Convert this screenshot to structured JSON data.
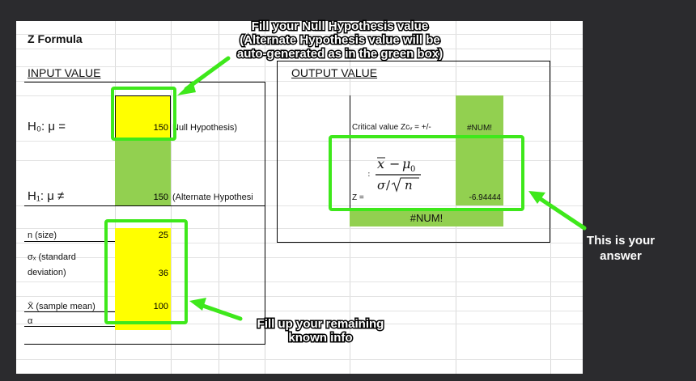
{
  "sheet": {
    "title": "Z Formula",
    "input_header": "INPUT VALUE",
    "output_header": "OUTPUT VALUE",
    "h0_label": "H₀: μ =",
    "h0_value": "150",
    "h0_note": "Null Hypothesis)",
    "h1_label": "H₁: μ ≠",
    "h1_value": "150",
    "h1_note": "(Alternate Hypothesi",
    "n_label": "n (size)",
    "n_value": "25",
    "sigma_label_1": "σₓ (standard",
    "sigma_label_2": "deviation)",
    "sigma_value": "36",
    "xbar_label": "X̄ (sample mean)",
    "xbar_value": "100",
    "alpha_label": "α",
    "critical_label": "Critical value Zᴄᵥ = +/-",
    "critical_value": "#NUM!",
    "z_label": "Z =",
    "z_value": "-6.94444",
    "result_value": "#NUM!"
  },
  "callouts": {
    "top": "Fill your Null Hypothesis value (Alternate Hypothesis value will be auto-generated as in the green box)",
    "bottom": "Fill up your remaining known info",
    "right": "This is your answer"
  },
  "colors": {
    "input_cell": "#ffff00",
    "auto_cell": "#92d050",
    "highlight": "#3ee81b",
    "background": "#2b2b2e"
  }
}
